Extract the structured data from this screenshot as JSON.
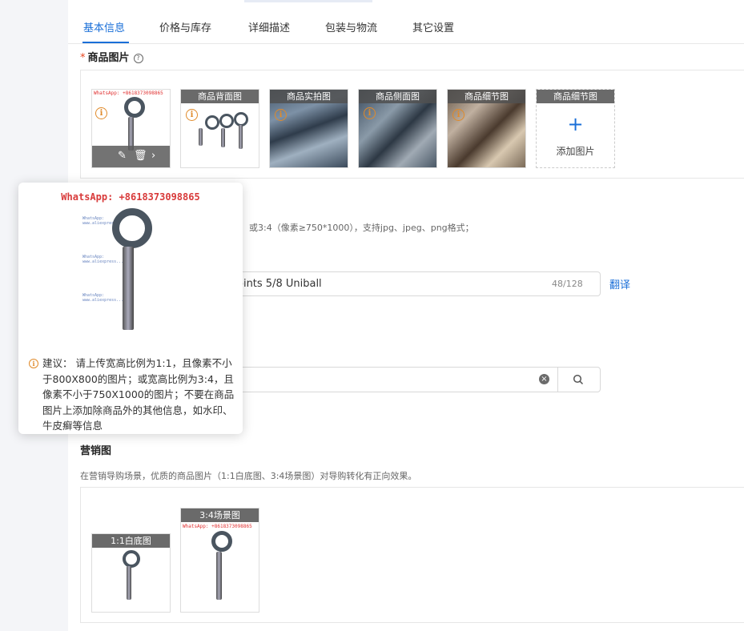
{
  "tabs": [
    {
      "label": "基本信息",
      "active": true
    },
    {
      "label": "价格与库存",
      "active": false
    },
    {
      "label": "详细描述",
      "active": false
    },
    {
      "label": "包装与物流",
      "active": false
    },
    {
      "label": "其它设置",
      "active": false
    }
  ],
  "product_images": {
    "required_mark": "*",
    "title": "商品图片",
    "help_icon": "question-circle-icon",
    "thumbnails": [
      {
        "label": "",
        "watermark": "WhatsApp: +8618373098865"
      },
      {
        "label": "商品背面图"
      },
      {
        "label": "商品实拍图"
      },
      {
        "label": "商品侧面图"
      },
      {
        "label": "商品细节图"
      }
    ],
    "add_tile": {
      "label": "商品细节图",
      "plus": "+",
      "text": "添加图片"
    }
  },
  "hint": {
    "text": "或3:4（像素≥750*1000），支持jpg、jpeg、png格式；"
  },
  "title_field": {
    "value": "oints 5/8 Uniball",
    "count": "48/128",
    "translate": "翻译"
  },
  "search_field": {
    "clear": "×"
  },
  "popover": {
    "watermark": "WhatsApp: +8618373098865",
    "advice": "建议： 请上传宽高比例为1:1，且像素不小于800X800的图片；或宽高比例为3:4，且像素不小于750X1000的图片；不要在商品图片上添加除商品外的其他信息，如水印、牛皮癣等信息"
  },
  "marketing": {
    "title": "营销图",
    "description": "在营销导购场景，优质的商品图片（1:1白底图、3:4场景图）对导购转化有正向效果。",
    "tiles": [
      {
        "label": "1:1白底图"
      },
      {
        "label": "3:4场景图",
        "watermark": "WhatsApp: +8618373098865"
      }
    ]
  },
  "colors": {
    "accent": "#1a6fd8",
    "required": "#e8451e",
    "warning": "#e08a2a",
    "watermark": "#d83a3a"
  }
}
